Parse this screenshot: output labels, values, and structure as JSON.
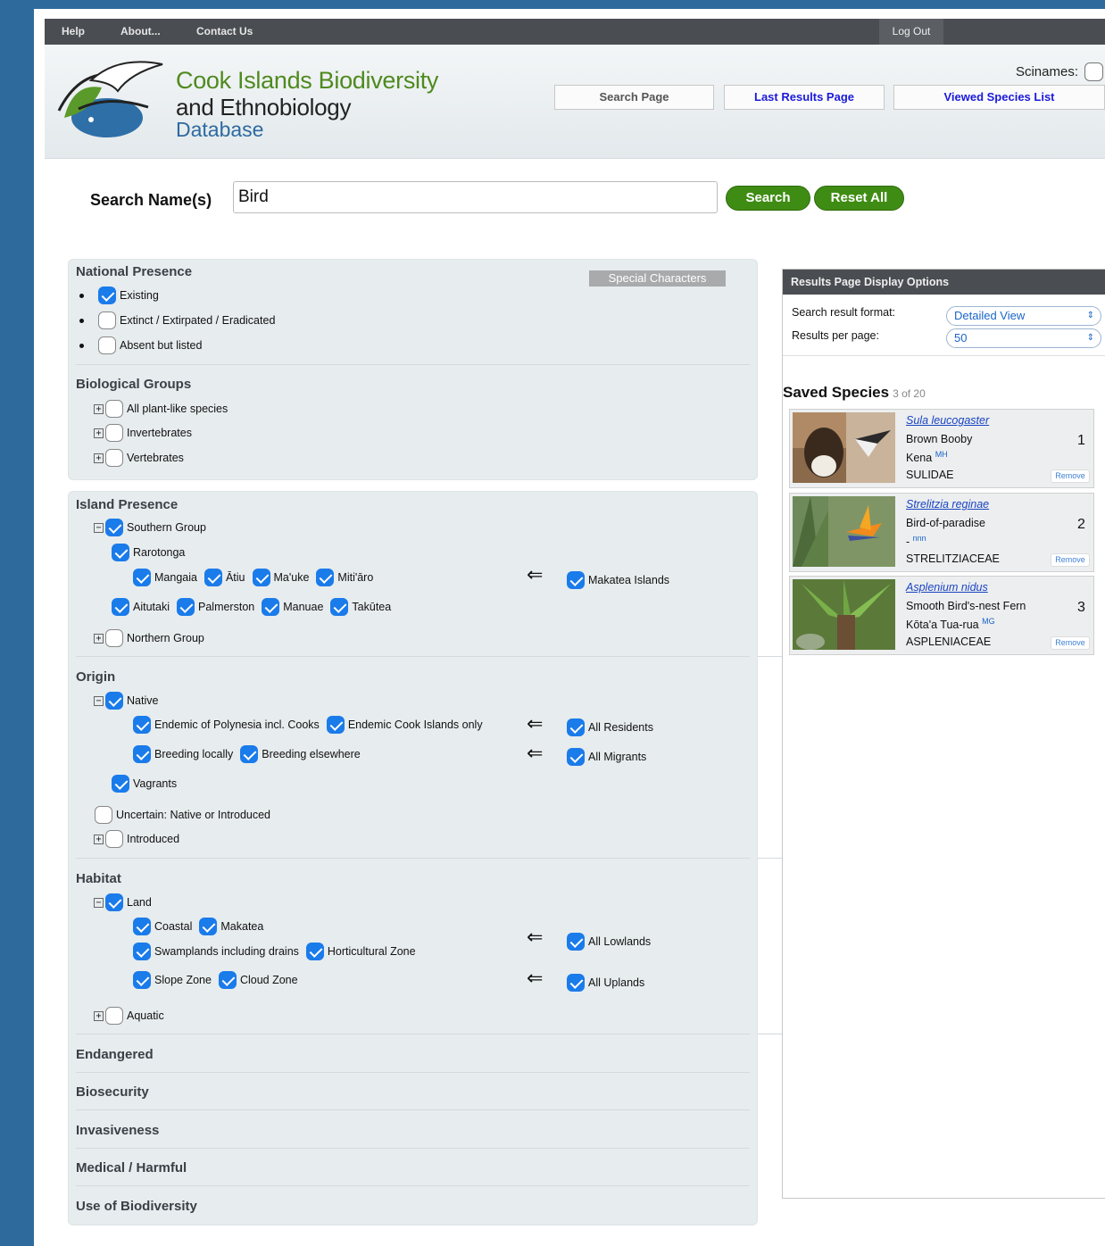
{
  "nav": {
    "help": "Help",
    "about": "About...",
    "contact": "Contact Us",
    "logout": "Log Out"
  },
  "header": {
    "title_line1": "Cook Islands Biodiversity",
    "title_line2": "and Ethnobiology",
    "title_line3": "Database",
    "scinames_label": "Scinames:",
    "search_page": "Search Page",
    "last_results": "Last Results Page",
    "viewed_species": "Viewed Species List"
  },
  "search": {
    "label": "Search Name(s)",
    "value": "Bird",
    "search_button": "Search",
    "reset_button": "Reset All"
  },
  "special_characters": "Special Characters",
  "national_presence": {
    "title": "National Presence",
    "items": [
      {
        "label": "Existing",
        "checked": true
      },
      {
        "label": "Extinct / Extirpated / Eradicated",
        "checked": false
      },
      {
        "label": "Absent but listed",
        "checked": false
      }
    ]
  },
  "biological_groups": {
    "title": "Biological Groups",
    "items": [
      {
        "label": "All plant-like species",
        "checked": false
      },
      {
        "label": "Invertebrates",
        "checked": false
      },
      {
        "label": "Vertebrates",
        "checked": false
      }
    ]
  },
  "island_presence": {
    "title": "Island Presence",
    "southern_group": "Southern Group",
    "rarotonga": "Rarotonga",
    "row1": [
      "Mangaia",
      "Ātiu",
      "Ma'uke",
      "Miti'āro"
    ],
    "row2": [
      "Aitutaki",
      "Palmerston",
      "Manuae",
      "Takūtea"
    ],
    "makatea_islands": "Makatea Islands",
    "northern_group": "Northern Group"
  },
  "origin": {
    "title": "Origin",
    "native": "Native",
    "endemic_polynesia": "Endemic of Polynesia incl. Cooks",
    "endemic_cook": "Endemic Cook Islands only",
    "all_residents": "All Residents",
    "breeding_locally": "Breeding locally",
    "breeding_elsewhere": "Breeding elsewhere",
    "all_migrants": "All Migrants",
    "vagrants": "Vagrants",
    "uncertain": "Uncertain: Native or Introduced",
    "introduced": "Introduced"
  },
  "habitat": {
    "title": "Habitat",
    "land": "Land",
    "coastal": "Coastal",
    "makatea": "Makatea",
    "swamplands": "Swamplands including drains",
    "horticultural": "Horticultural Zone",
    "all_lowlands": "All Lowlands",
    "slope": "Slope Zone",
    "cloud": "Cloud Zone",
    "all_uplands": "All Uplands",
    "aquatic": "Aquatic"
  },
  "collapsed_sections": [
    "Endangered",
    "Biosecurity",
    "Invasiveness",
    "Medical / Harmful",
    "Use of Biodiversity"
  ],
  "arrow_glyph": "⇐",
  "display_options": {
    "title": "Results Page Display Options",
    "format_label": "Search result format:",
    "format_value": "Detailed View",
    "per_page_label": "Results per page:",
    "per_page_value": "50"
  },
  "saved_species": {
    "title": "Saved Species",
    "count": "3 of 20",
    "remove_label": "Remove",
    "items": [
      {
        "scientific": "Sula leucogaster",
        "common": "Brown Booby",
        "local": "Kena",
        "local_tag": "MH",
        "family": "SULIDAE",
        "number": "1"
      },
      {
        "scientific": "Strelitzia reginae",
        "common": "Bird-of-paradise",
        "local": "-",
        "local_tag": "nnn",
        "family": "STRELITZIACEAE",
        "number": "2"
      },
      {
        "scientific": "Asplenium nidus",
        "common": "Smooth Bird's-nest Fern",
        "local": "Kōta'a Tua-rua",
        "local_tag": "MG",
        "family": "ASPLENIACEAE",
        "number": "3"
      }
    ]
  },
  "colors": {
    "accent_blue": "#1a7bea",
    "brand_green": "#4f8a1e",
    "button_green": "#3f8c14",
    "nav_dark": "#4a4d52"
  }
}
